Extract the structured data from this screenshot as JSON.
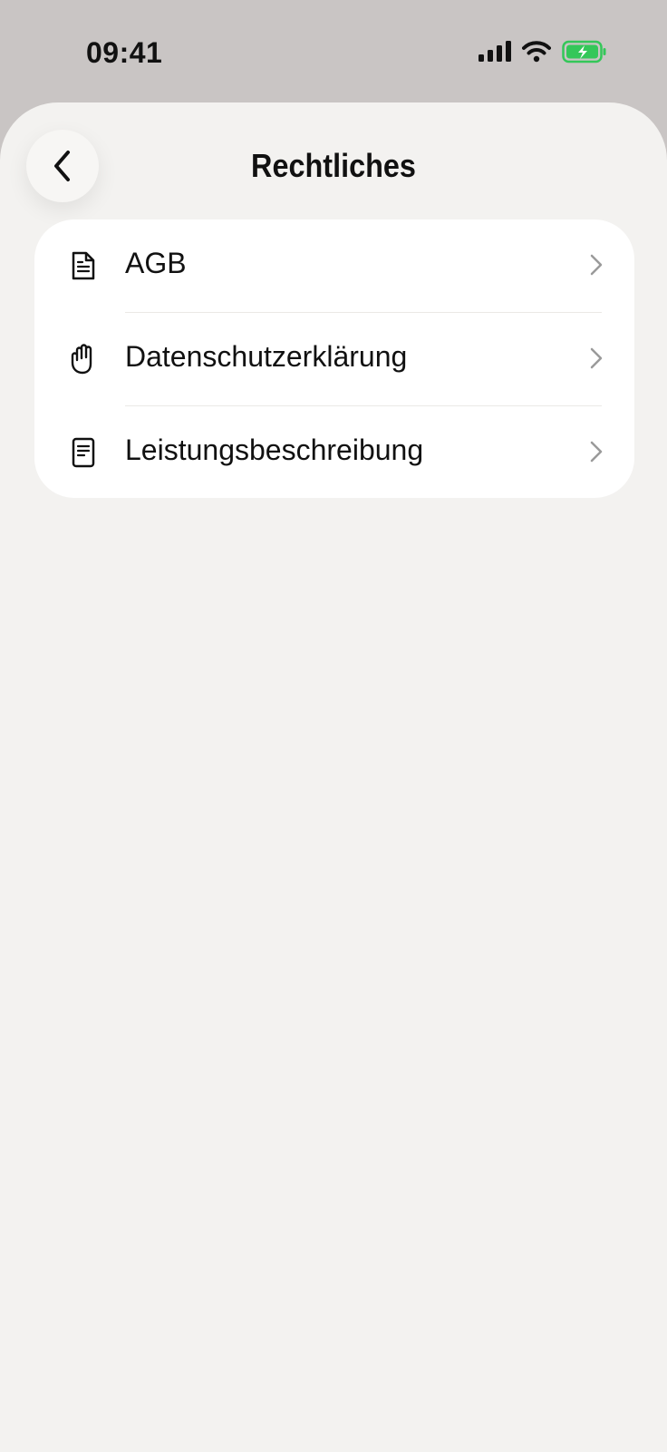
{
  "status_bar": {
    "time": "09:41",
    "battery_color": "#34c759"
  },
  "header": {
    "title": "Rechtliches",
    "back_icon": "chevron-left-icon"
  },
  "menu": {
    "items": [
      {
        "label": "AGB",
        "icon": "document-icon"
      },
      {
        "label": "Datenschutzerklärung",
        "icon": "hand-icon"
      },
      {
        "label": "Leistungsbeschreibung",
        "icon": "list-document-icon"
      }
    ]
  }
}
